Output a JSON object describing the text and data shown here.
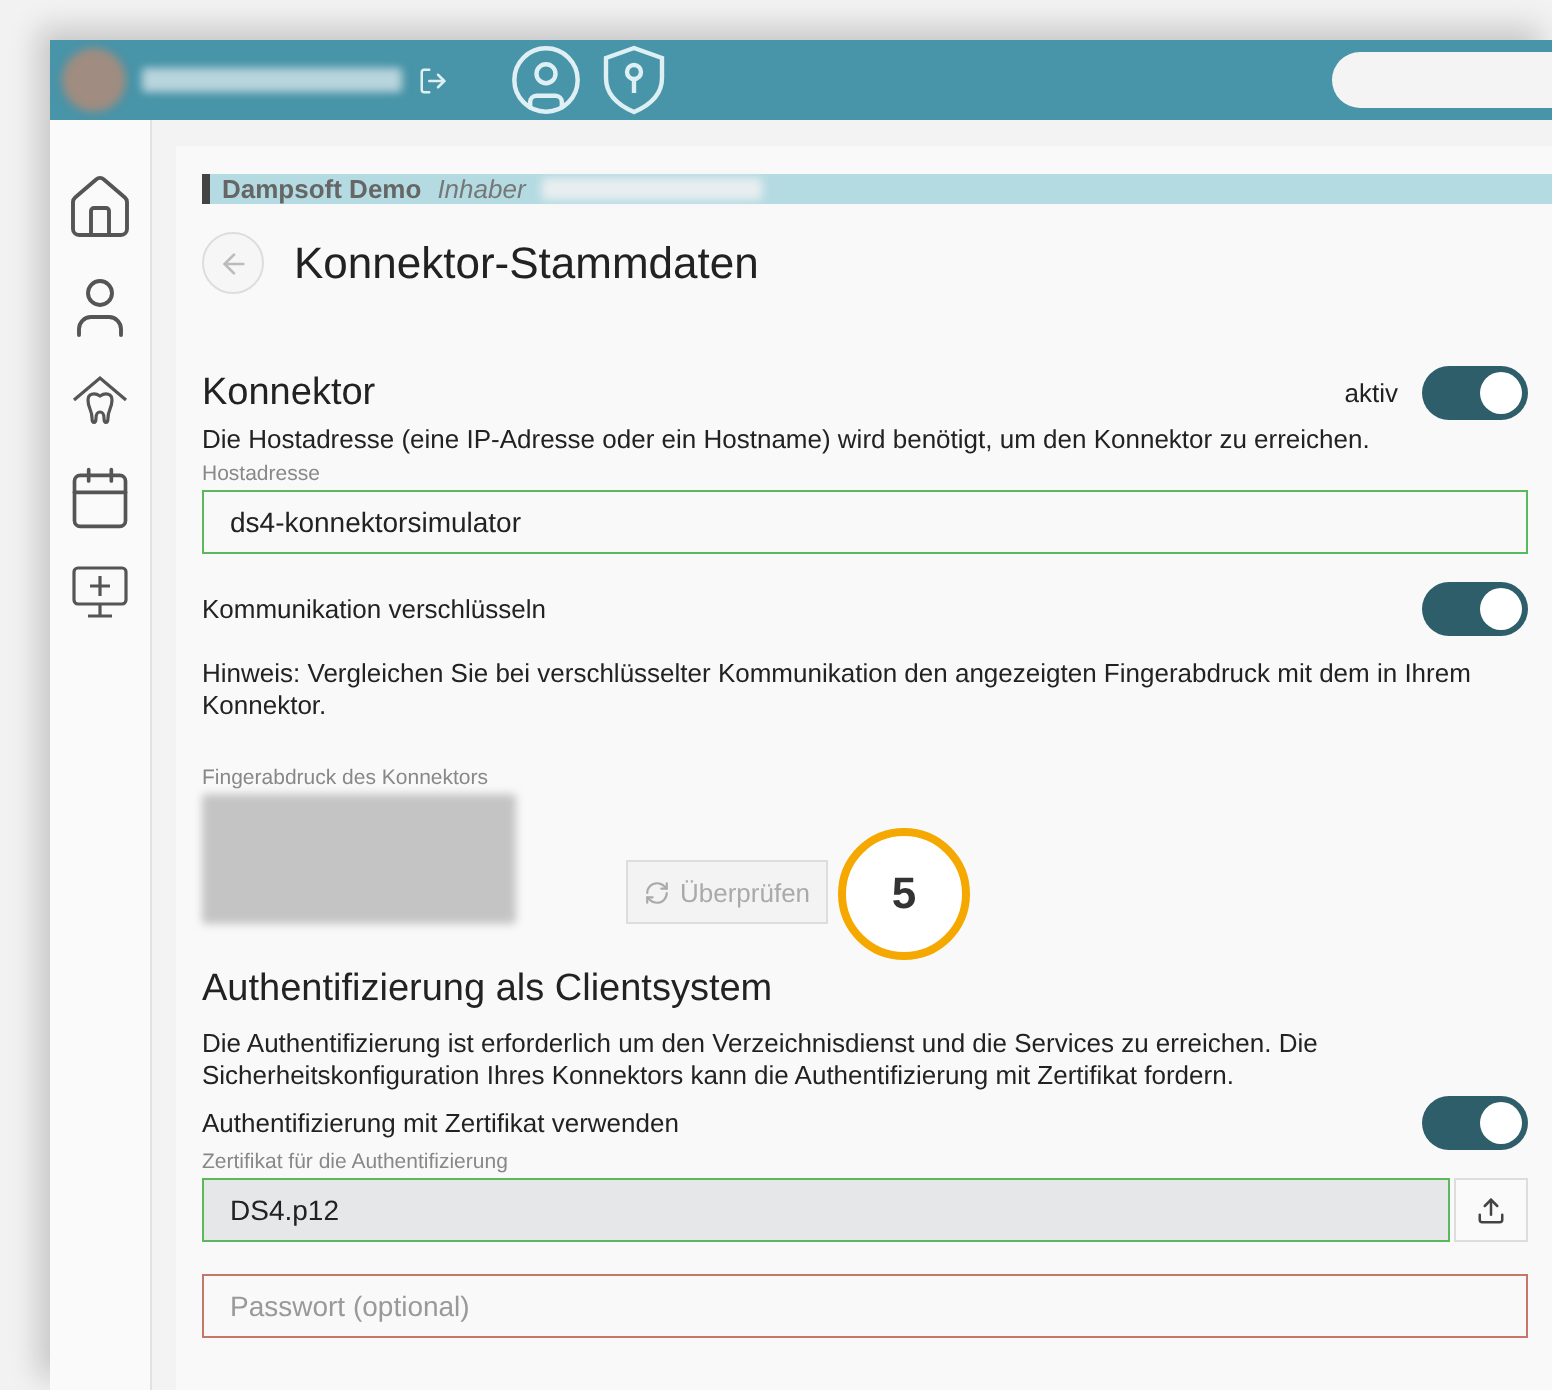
{
  "breadcrumb": {
    "company": "Dampsoft Demo",
    "role": "Inhaber"
  },
  "title": "Konnektor-Stammdaten",
  "konnektor": {
    "heading": "Konnektor",
    "active": {
      "label": "aktiv",
      "on": true
    },
    "description": "Die Hostadresse (eine IP-Adresse oder ein Hostname) wird benötigt, um den Konnektor zu erreichen.",
    "host": {
      "label": "Hostadresse",
      "value": "ds4-konnektorsimulator"
    },
    "encrypt": {
      "label": "Kommunikation verschlüsseln",
      "on": true
    },
    "hint": "Hinweis: Vergleichen Sie bei verschlüsselter Kommunikation den angezeigten Fingerabdruck mit dem in Ihrem Konnektor.",
    "fingerprint_label": "Fingerabdruck des Konnektors",
    "verify_button": {
      "label": "Überprüfen",
      "disabled": true
    },
    "callout": "5"
  },
  "auth": {
    "heading": "Authentifizierung als Clientsystem",
    "description": "Die Authentifizierung ist erforderlich um den Verzeichnisdienst und die Services zu erreichen. Die Sicherheitskonfiguration Ihres Konnektors kann die Authentifizierung mit Zertifikat fordern.",
    "use_cert": {
      "label": "Authentifizierung mit Zertifikat verwenden",
      "on": true
    },
    "cert": {
      "label": "Zertifikat für die Authentifizierung",
      "value": "DS4.p12"
    },
    "password": {
      "placeholder": "Passwort (optional)"
    }
  }
}
